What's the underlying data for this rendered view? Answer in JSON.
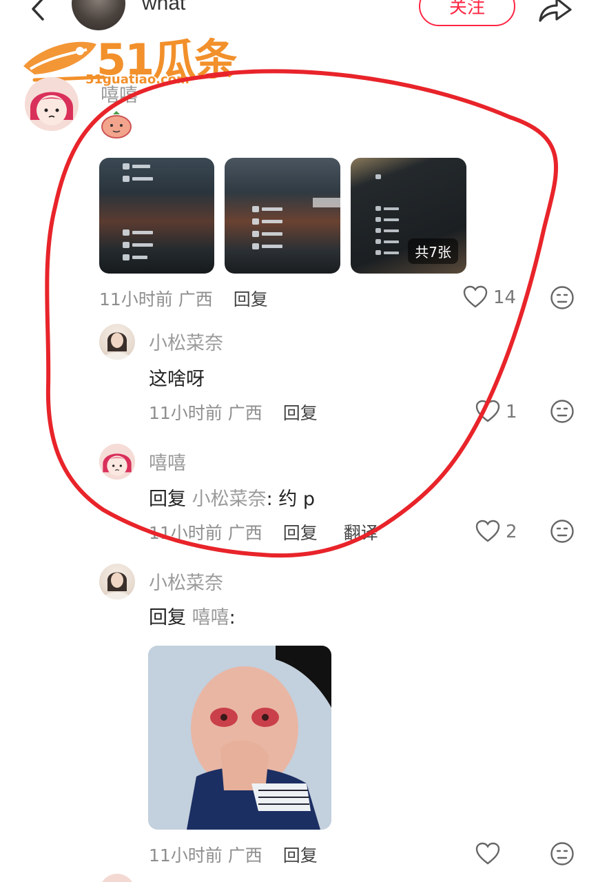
{
  "header": {
    "author_name": "what",
    "follow_label": "关注"
  },
  "watermark": {
    "logo_text": "51瓜条",
    "url_text": "51guatiao.com"
  },
  "comments": [
    {
      "username": "嘻嘻",
      "image_count_label": "共7张",
      "time": "11小时前",
      "location": "广西",
      "reply_label": "回复",
      "likes": "14"
    }
  ],
  "replies": [
    {
      "username": "小松菜奈",
      "text": "这啥呀",
      "time": "11小时前",
      "location": "广西",
      "reply_label": "回复",
      "likes": "1"
    },
    {
      "username": "嘻嘻",
      "reply_prefix": "回复",
      "reply_to": "小松菜奈",
      "text": ": 约 p",
      "time": "11小时前",
      "location": "广西",
      "reply_label": "回复",
      "translate_label": "翻译",
      "likes": "2"
    },
    {
      "username": "小松菜奈",
      "reply_prefix": "回复",
      "reply_to": "嘻嘻",
      "text": ":",
      "time": "11小时前",
      "location": "广西",
      "reply_label": "回复"
    }
  ],
  "colors": {
    "accent": "#ff2442",
    "watermark": "#f2902b",
    "annotation": "#e8242a"
  }
}
